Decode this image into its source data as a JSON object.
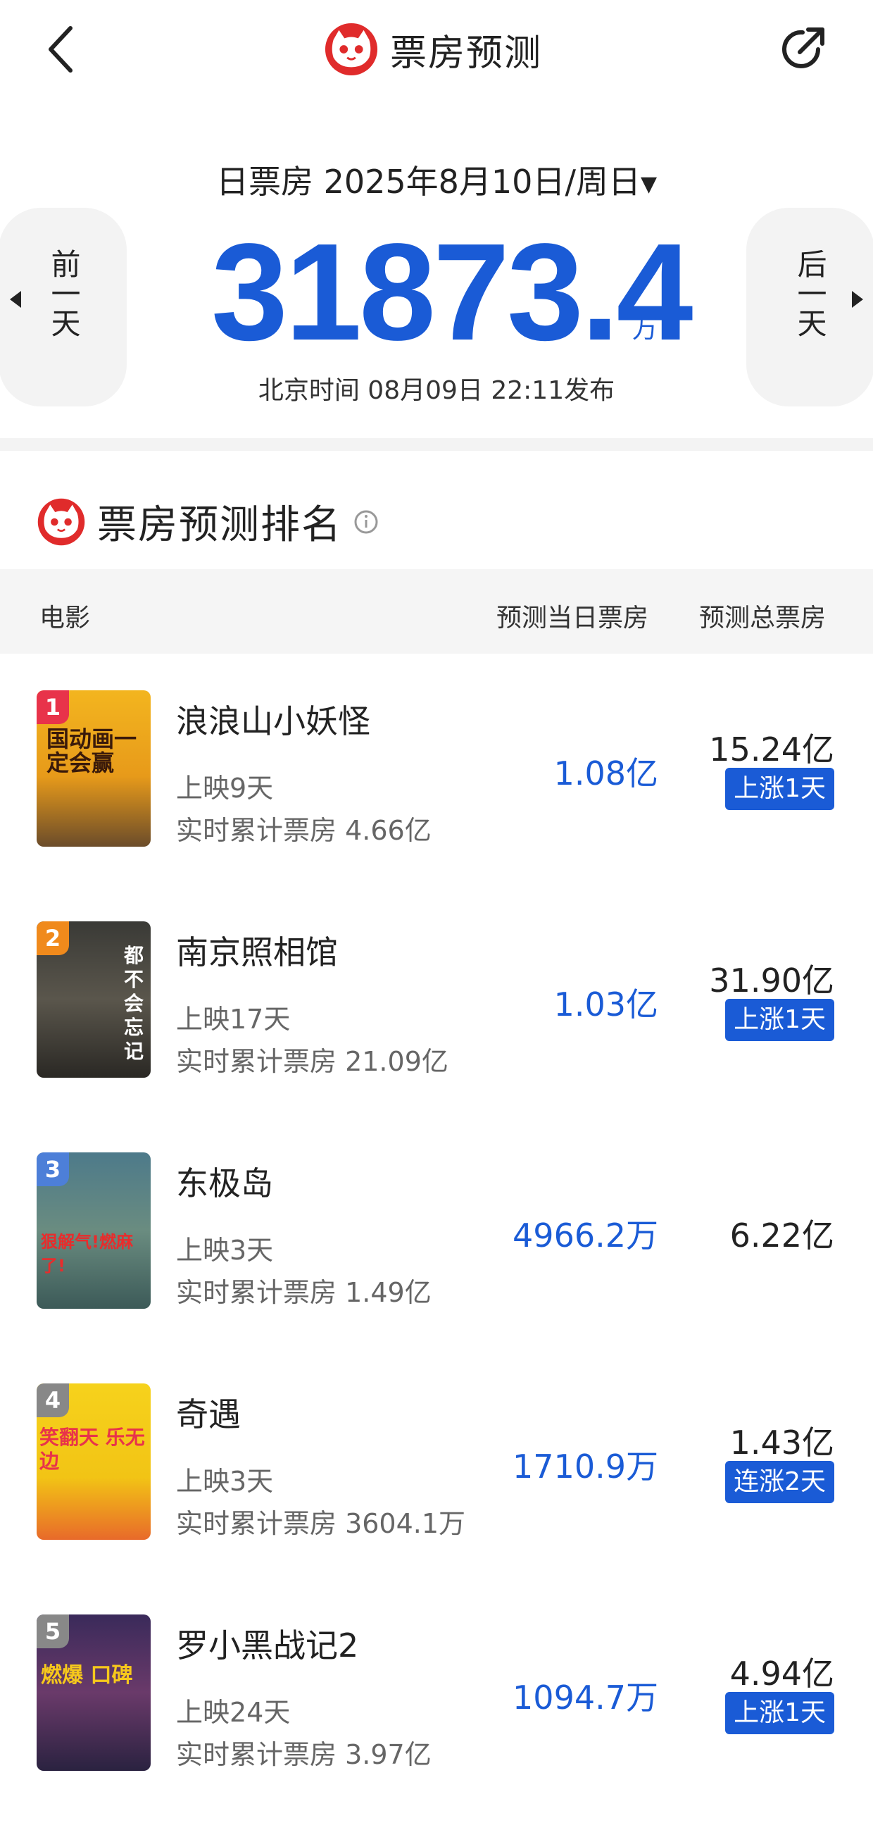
{
  "header": {
    "title": "票房预测",
    "back_icon": "chevron-left-icon",
    "share_icon": "share-icon",
    "logo_icon": "cat-logo-icon"
  },
  "summary": {
    "date_label": "日票房 2025年8月10日/周日",
    "caret": "▼",
    "value": "31873.4",
    "unit": "万",
    "publish_time": "北京时间  08月09日  22:11发布",
    "prev_label": "前一天",
    "next_label": "后一天"
  },
  "ranking": {
    "title": "票房预测排名",
    "columns": {
      "movie": "电影",
      "day": "预测当日票房",
      "total": "预测总票房"
    },
    "accent_color": "#1a5bd6",
    "items": [
      {
        "rank": "1",
        "name": "浪浪山小妖怪",
        "days": "上映9天",
        "cumulative": "实时累计票房 4.66亿",
        "day_forecast": "1.08亿",
        "total_forecast": "15.24亿",
        "trend": "上涨1天",
        "poster_text": "国动画一定会赢",
        "badge_color": "#e8334a"
      },
      {
        "rank": "2",
        "name": "南京照相馆",
        "days": "上映17天",
        "cumulative": "实时累计票房 21.09亿",
        "day_forecast": "1.03亿",
        "total_forecast": "31.90亿",
        "trend": "上涨1天",
        "poster_text": "都不会忘记",
        "badge_color": "#f08a1c"
      },
      {
        "rank": "3",
        "name": "东极岛",
        "days": "上映3天",
        "cumulative": "实时累计票房 1.49亿",
        "day_forecast": "4966.2万",
        "total_forecast": "6.22亿",
        "trend": "",
        "poster_text": "狠解气!燃麻了!",
        "badge_color": "#4d7fd8"
      },
      {
        "rank": "4",
        "name": "奇遇",
        "days": "上映3天",
        "cumulative": "实时累计票房 3604.1万",
        "day_forecast": "1710.9万",
        "total_forecast": "1.43亿",
        "trend": "连涨2天",
        "poster_text": "笑翻天 乐无边",
        "badge_color": "#888888"
      },
      {
        "rank": "5",
        "name": "罗小黑战记2",
        "days": "上映24天",
        "cumulative": "实时累计票房 3.97亿",
        "day_forecast": "1094.7万",
        "total_forecast": "4.94亿",
        "trend": "上涨1天",
        "poster_text": "燃爆 口碑",
        "badge_color": "#888888"
      }
    ]
  }
}
